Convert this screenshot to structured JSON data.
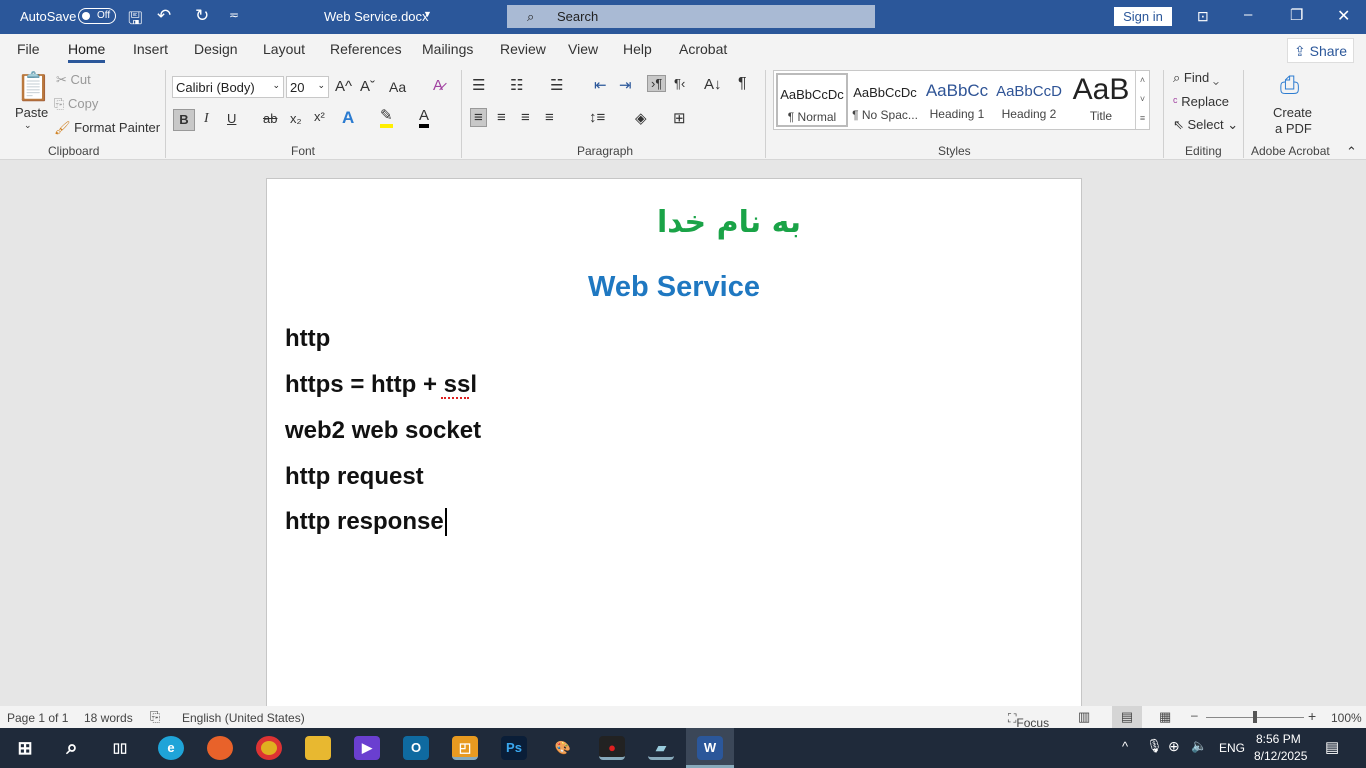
{
  "titlebar": {
    "autosave": "AutoSave",
    "autosave_state": "Off",
    "doc_title": "Web Service.docx",
    "search": "Search",
    "signin": "Sign in"
  },
  "tabs": [
    "File",
    "Home",
    "Insert",
    "Design",
    "Layout",
    "References",
    "Mailings",
    "Review",
    "View",
    "Help",
    "Acrobat"
  ],
  "share": "Share",
  "clipboard": {
    "paste": "Paste",
    "cut": "Cut",
    "copy": "Copy",
    "format_painter": "Format Painter",
    "label": "Clipboard"
  },
  "font": {
    "name": "Calibri (Body)",
    "size": "20",
    "label": "Font",
    "bold": "B",
    "italic": "I",
    "underline": "U",
    "strike": "ab",
    "sub": "x₂",
    "sup": "x²",
    "grow": "A^",
    "shrink": "Aˇ",
    "case": "Aa"
  },
  "paragraph": {
    "label": "Paragraph"
  },
  "styles": {
    "label": "Styles",
    "items": [
      {
        "preview": "AaBbCcDc",
        "name": "¶ Normal"
      },
      {
        "preview": "AaBbCcDc",
        "name": "¶ No Spac..."
      },
      {
        "preview": "AaBbCc",
        "name": "Heading 1"
      },
      {
        "preview": "AaBbCcD",
        "name": "Heading 2"
      },
      {
        "preview": "AaB",
        "name": "Title"
      }
    ]
  },
  "editing": {
    "find": "Find",
    "replace": "Replace",
    "select": "Select",
    "label": "Editing"
  },
  "acrobat": {
    "create1": "Create",
    "create2": "a PDF",
    "label": "Adobe Acrobat"
  },
  "document": {
    "arabic_title": "به نام خدا",
    "title": "Web Service",
    "lines": [
      "http",
      "https = http + ssl",
      "web2 web socket",
      "http request",
      "http response"
    ]
  },
  "colors": {
    "title_green": "#1aa347",
    "title_blue": "#1f78c1",
    "accent": "#2b579a"
  },
  "status": {
    "page": "Page 1 of 1",
    "words": "18 words",
    "language": "English (United States)",
    "focus": "Focus",
    "zoom": "100%",
    "zoom_fraction": 0.5
  },
  "taskbar": {
    "lang": "ENG",
    "time": "8:56 PM",
    "date": "8/12/2025"
  }
}
